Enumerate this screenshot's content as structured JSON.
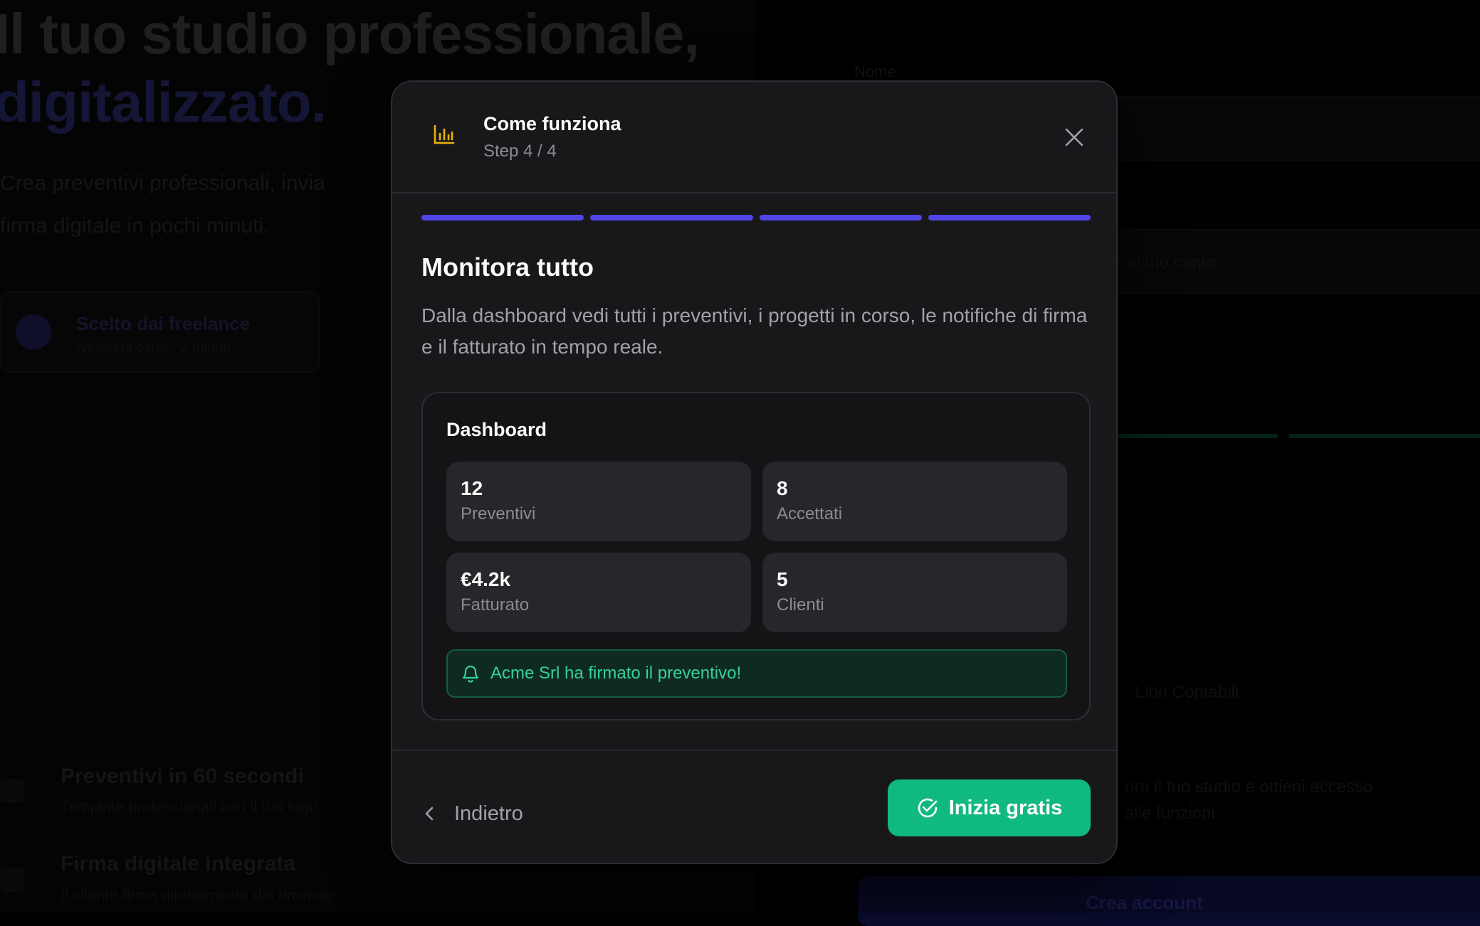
{
  "background": {
    "hero_line1": "Il tuo studio professionale,",
    "hero_line2": "digitalizzato.",
    "hero_sub_line1": "Crea preventivi professionali, invia",
    "hero_sub_line2": "firma digitale in pochi minuti.",
    "card_title": "Scelto dai freelance",
    "card_sub": "Nessuna carta · 2 minuti",
    "feature1_title": "Preventivi in 60 secondi",
    "feature1_sub": "Template professionali con il tuo logo",
    "feature2_title": "Firma digitale integrata",
    "feature2_sub": "Il cliente firma direttamente dal browser",
    "right_label": "Nome",
    "right_hint1": "nel tuo conto",
    "right_hint2": "· Libri Contabili",
    "right_hint3": "ora il tuo studio e ottieni accesso",
    "right_hint4": "alle funzioni",
    "right_button": "Crea account"
  },
  "modal": {
    "title": "Come funziona",
    "step": "Step 4 / 4",
    "progress": {
      "current": 4,
      "total": 4,
      "color": "#4f46e5"
    },
    "heading": "Monitora tutto",
    "description": "Dalla dashboard vedi tutti i preventivi, i progetti in corso, le notifiche di firma e il fatturato in tempo reale.",
    "dashboard": {
      "title": "Dashboard",
      "stats": [
        {
          "value": "12",
          "label": "Preventivi"
        },
        {
          "value": "8",
          "label": "Accettati"
        },
        {
          "value": "€4.2k",
          "label": "Fatturato"
        },
        {
          "value": "5",
          "label": "Clienti"
        }
      ],
      "notification": "Acme Srl ha firmato il preventivo!"
    },
    "back_label": "Indietro",
    "cta_label": "Inizia gratis",
    "icons": {
      "header": "bar-chart-icon",
      "close": "close-icon",
      "notification": "bell-icon",
      "back": "chevron-left-icon",
      "cta": "check-circle-icon"
    },
    "colors": {
      "accent": "#4f46e5",
      "success": "#10b981",
      "header_icon": "#eab308"
    }
  }
}
